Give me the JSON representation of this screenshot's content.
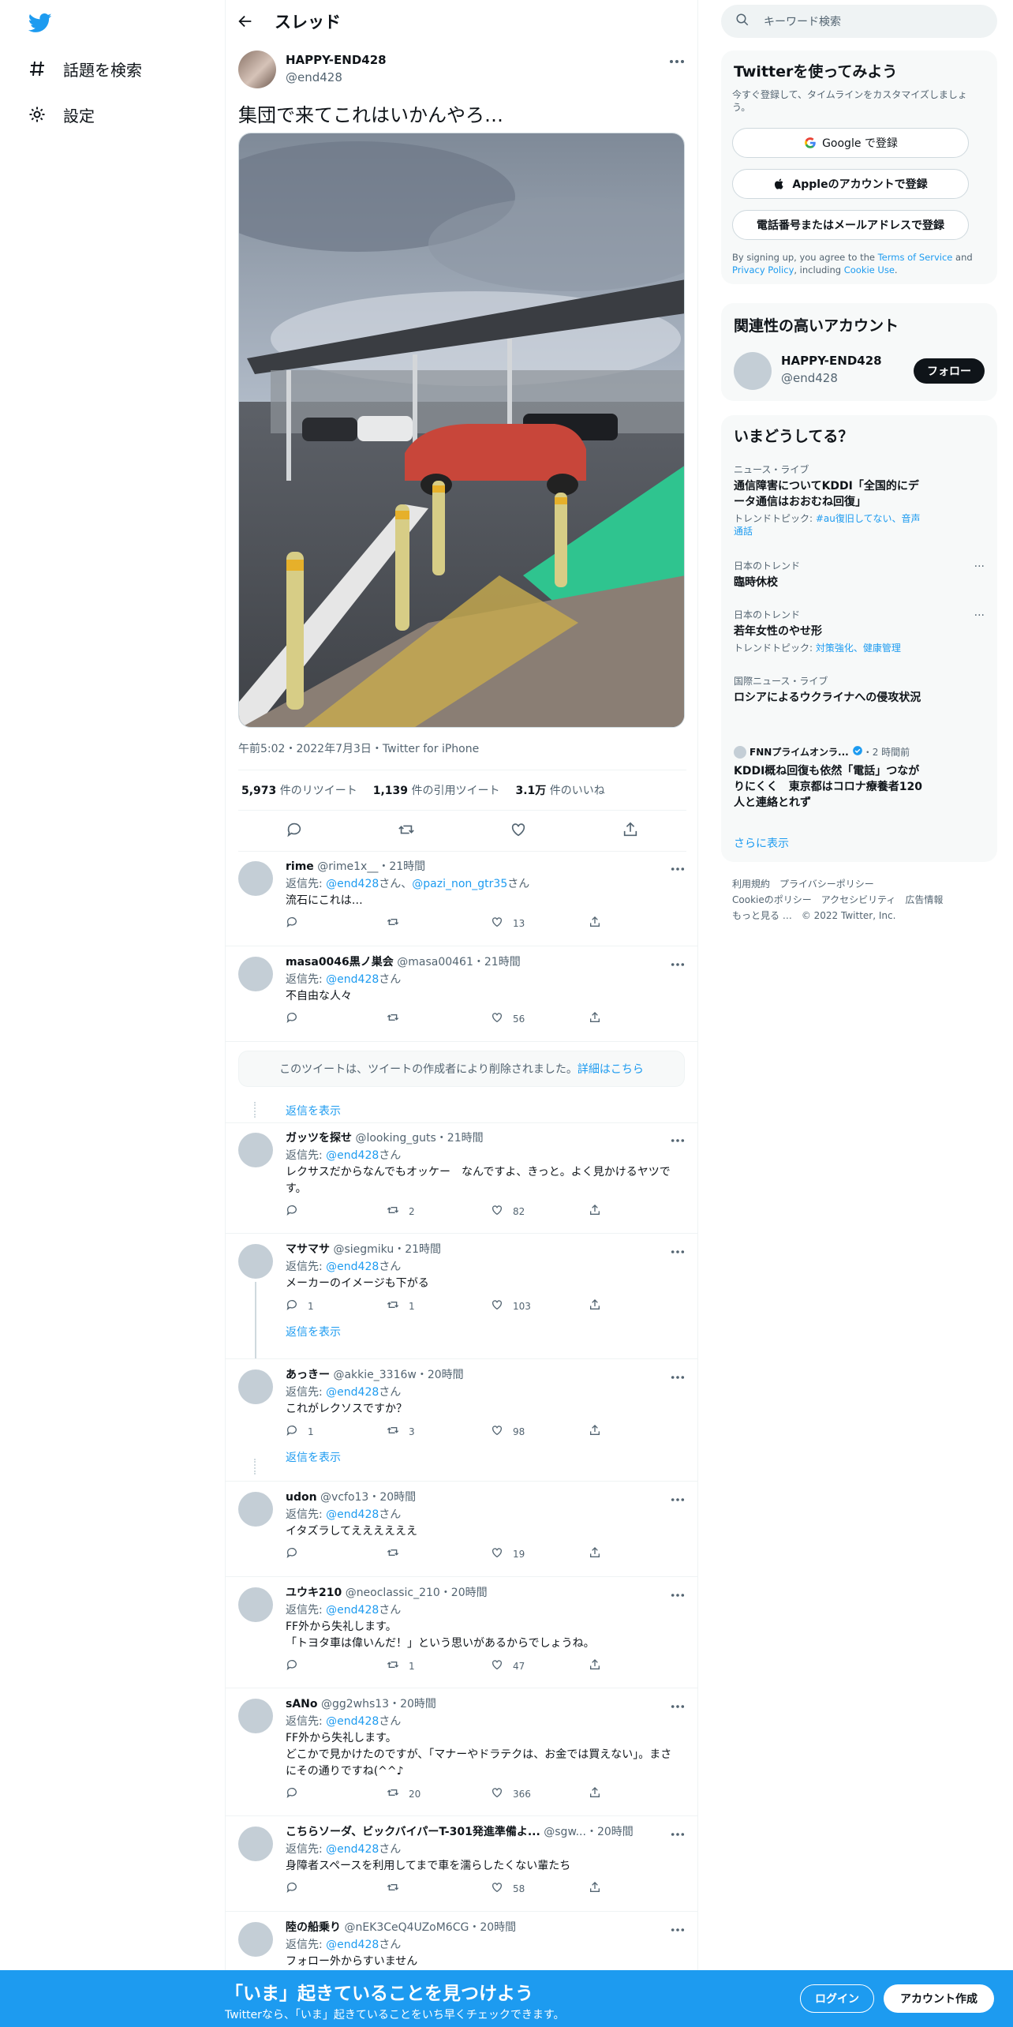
{
  "colors": {
    "accent": "#1d9bf0",
    "banner": "#1d9bf0",
    "text": "#0f1419",
    "muted": "#536471"
  },
  "nav": {
    "explore": "話題を検索",
    "settings": "設定"
  },
  "header": {
    "title": "スレッド"
  },
  "tweet": {
    "name": "HAPPY-END428",
    "handle": "@end428",
    "text": "集団で来てこれはいかんやろ…",
    "meta": "午前5:02・2022年7月3日・Twitter for iPhone",
    "retweets": "5,973",
    "retweets_label": "件のリツイート",
    "quotes": "1,139",
    "quotes_label": "件の引用ツイート",
    "likes": "3.1万",
    "likes_label": "件のいいね"
  },
  "replies": [
    {
      "name": "rime",
      "handle": "@rime1x__",
      "time": "・21時間",
      "to_prefix": "返信先: ",
      "to": "@end428",
      "to_suffix": "さん、",
      "to2": "@pazi_non_gtr35",
      "to2_suffix": "さん",
      "text": "流石にこれは…",
      "reply": "",
      "retweet": "",
      "like": "13"
    },
    {
      "name": "masa0046黒ノ巣会",
      "handle": "@masa00461",
      "time": "・21時間",
      "to_prefix": "返信先: ",
      "to": "@end428",
      "to_suffix": "さん",
      "text": "不自由な人々",
      "reply": "",
      "retweet": "",
      "like": "56"
    },
    {
      "name": "ガッツを探せ",
      "handle": "@looking_guts",
      "time": "・21時間",
      "to_prefix": "返信先: ",
      "to": "@end428",
      "to_suffix": "さん",
      "text": "レクサスだからなんでもオッケー　なんですよ、きっと。よく見かけるヤツです。",
      "reply": "",
      "retweet": "2",
      "like": "82"
    },
    {
      "name": "マサマサ",
      "handle": "@siegmiku",
      "time": "・21時間",
      "to_prefix": "返信先: ",
      "to": "@end428",
      "to_suffix": "さん",
      "text": "メーカーのイメージも下がる",
      "reply": "1",
      "retweet": "1",
      "like": "103"
    },
    {
      "name": "あっきー",
      "handle": "@akkie_3316w",
      "time": "・20時間",
      "to_prefix": "返信先: ",
      "to": "@end428",
      "to_suffix": "さん",
      "text": "これがレクソスですか？",
      "reply": "1",
      "retweet": "3",
      "like": "98"
    },
    {
      "name": "udon",
      "handle": "@vcfo13",
      "time": "・20時間",
      "to_prefix": "返信先: ",
      "to": "@end428",
      "to_suffix": "さん",
      "text": "イタズラしてええええええ",
      "reply": "",
      "retweet": "",
      "like": "19"
    },
    {
      "name": "ユウキ210",
      "handle": "@neoclassic_210",
      "time": "・20時間",
      "to_prefix": "返信先: ",
      "to": "@end428",
      "to_suffix": "さん",
      "text": "FF外から失礼します。\n「トヨタ車は偉いんだ！」という思いがあるからでしょうね。",
      "reply": "",
      "retweet": "1",
      "like": "47"
    },
    {
      "name": "sANo",
      "handle": "@gg2whs13",
      "time": "・20時間",
      "to_prefix": "返信先: ",
      "to": "@end428",
      "to_suffix": "さん",
      "text": "FF外から失礼します。\nどこかで見かけたのですが、「マナーやドラテクは、お金では買えない」。まさにその通りですね(^^♪",
      "reply": "",
      "retweet": "20",
      "like": "366"
    },
    {
      "name": "こちらソーダ、ビックバイパーT-301発進準備よ...",
      "handle": "@sgw...",
      "time": "・20時間",
      "to_prefix": "返信先: ",
      "to": "@end428",
      "to_suffix": "さん",
      "text": "身障者スペースを利用してまで車を濡らしたくない輩たち",
      "reply": "",
      "retweet": "",
      "like": "58"
    },
    {
      "name": "陸の船乗り",
      "handle": "@nEK3CeQ4UZoM6CG",
      "time": "・20時間",
      "to_prefix": "返信先: ",
      "to": "@end428",
      "to_suffix": "さん",
      "text": "フォロー外からすいません",
      "reply": "",
      "retweet": "",
      "like": ""
    }
  ],
  "deleted": {
    "text": "このツイートは、ツイートの作成者により削除されました。",
    "link": "詳細はこちら"
  },
  "show_replies": "返信を表示",
  "sidebar": {
    "search_placeholder": "キーワード検索",
    "signup": {
      "title": "Twitterを使ってみよう",
      "subtitle": "今すぐ登録して、タイムラインをカスタマイズしましょう。",
      "google": "Google で登録",
      "apple": "Appleのアカウントで登録",
      "phone": "電話番号またはメールアドレスで登録",
      "legal_prefix": "By signing up, you agree to the ",
      "tos": "Terms of Service",
      "legal_and": " and ",
      "privacy": "Privacy Policy",
      "legal_including": ", including ",
      "cookie": "Cookie Use",
      "legal_end": "."
    },
    "related": {
      "title": "関連性の高いアカウント",
      "name": "HAPPY-END428",
      "handle": "@end428",
      "follow": "フォロー"
    },
    "trends": {
      "title": "いまどうしてる？",
      "items": [
        {
          "category": "ニュース・ライブ",
          "title": "通信障害についてKDDI「全国的にデータ通信はおおむね回復」",
          "topics_label": "トレンドトピック: ",
          "topics": "#au復旧してない、音声通話"
        },
        {
          "category": "日本のトレンド",
          "title": "臨時休校"
        },
        {
          "category": "日本のトレンド",
          "title": "若年女性のやせ形",
          "topics_label": "トレンドトピック: ",
          "topics": "対策強化、健康管理"
        },
        {
          "category": "国際ニュース・ライブ",
          "title": "ロシアによるウクライナへの侵攻状況"
        },
        {
          "source": "FNNプライムオンラ...",
          "time": "・2 時間前",
          "title": "KDDI概ね回復も依然「電話」つながりにくく　東京都はコロナ療養者120人と連絡とれず"
        }
      ],
      "more": "さらに表示"
    },
    "footer": [
      "利用規約",
      "プライバシーポリシー",
      "Cookieのポリシー",
      "アクセシビリティ",
      "広告情報",
      "もっと見る …",
      "© 2022 Twitter, Inc."
    ]
  },
  "bottom": {
    "big": "「いま」起きていることを見つけよう",
    "small": "Twitterなら、「いま」起きていることをいち早くチェックできます。",
    "login": "ログイン",
    "signup": "アカウント作成"
  }
}
